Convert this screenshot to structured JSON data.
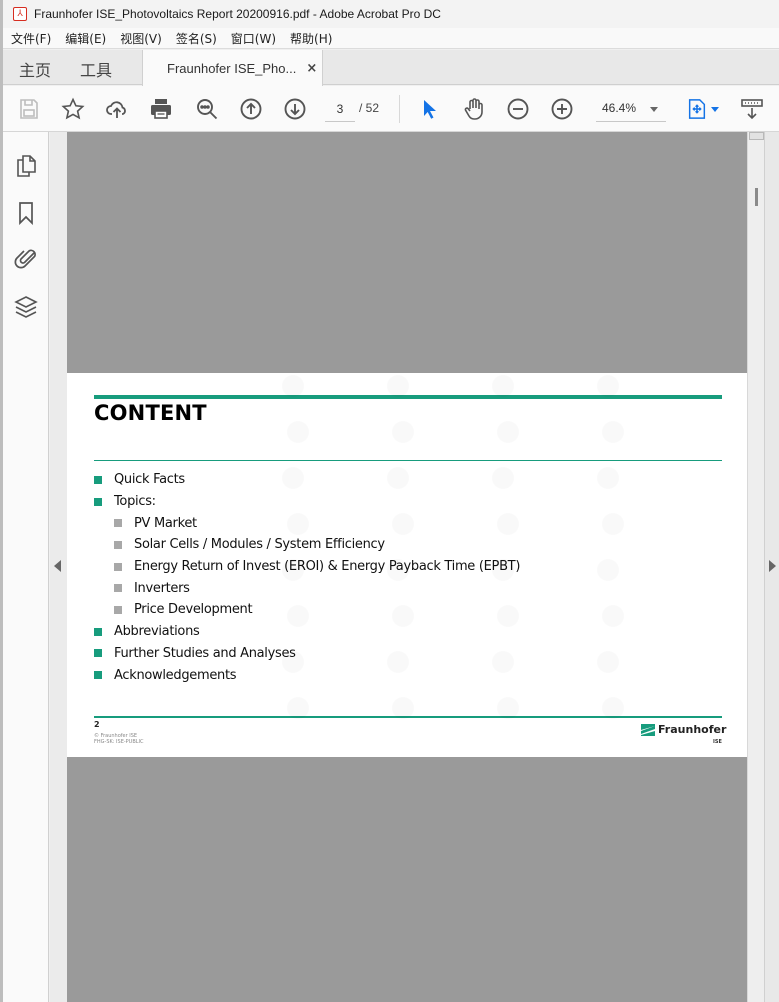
{
  "window": {
    "title": "Fraunhofer ISE_Photovoltaics Report 20200916.pdf - Adobe Acrobat Pro DC"
  },
  "menubar": {
    "items": [
      "文件(F)",
      "编辑(E)",
      "视图(V)",
      "签名(S)",
      "窗口(W)",
      "帮助(H)"
    ]
  },
  "tabs": {
    "home": "主页",
    "tools": "工具",
    "document": "Fraunhofer ISE_Pho...",
    "close": "×"
  },
  "toolbar": {
    "current_page": "3",
    "total_pages": "/ 52",
    "zoom": "46.4%",
    "accent_color": "#1473e6"
  },
  "page": {
    "heading": "CONTENT",
    "accent_color": "#179c7d",
    "toc": [
      {
        "text": "Quick Facts",
        "level": 1
      },
      {
        "text": "Topics:",
        "level": 1
      },
      {
        "text": "PV Market",
        "level": 2
      },
      {
        "text": "Solar Cells / Modules / System Efficiency",
        "level": 2
      },
      {
        "text": "Energy Return of Invest (EROI) & Energy Payback Time (EPBT)",
        "level": 2
      },
      {
        "text": "Inverters",
        "level": 2
      },
      {
        "text": "Price Development",
        "level": 2
      },
      {
        "text": "Abbreviations",
        "level": 1
      },
      {
        "text": "Further Studies and Analyses",
        "level": 1
      },
      {
        "text": "Acknowledgements",
        "level": 1
      }
    ],
    "footer": {
      "page_number": "2",
      "copyright": "© Fraunhofer ISE",
      "classification": "FHG-SK: ISE-PUBLIC",
      "logo_name": "Fraunhofer",
      "logo_sub": "ISE"
    }
  }
}
